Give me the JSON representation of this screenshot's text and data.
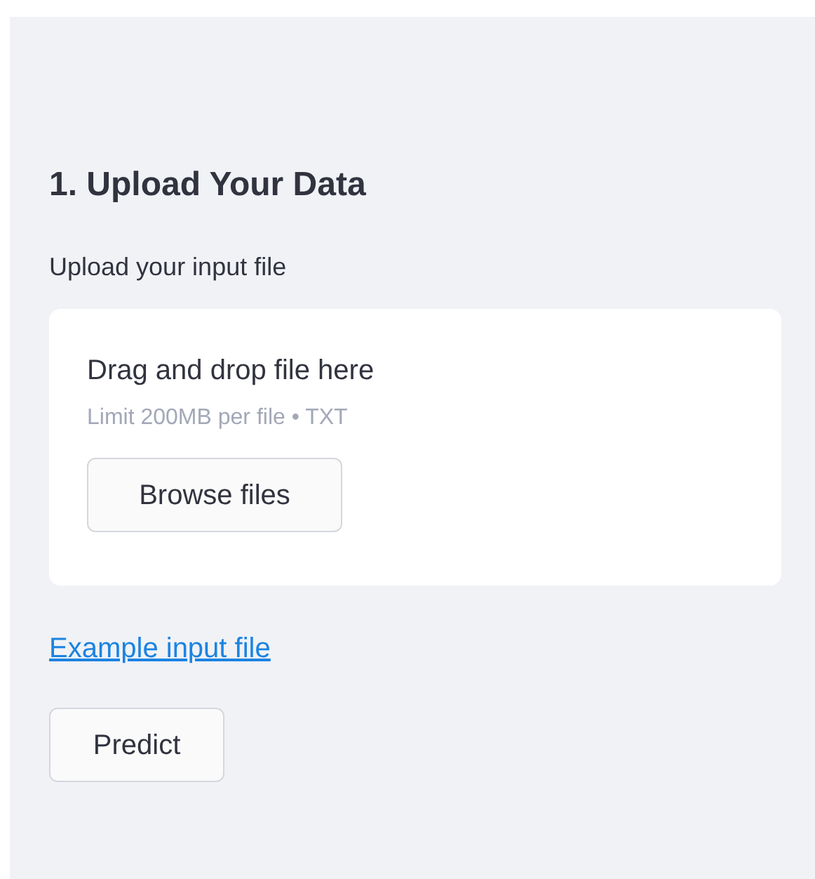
{
  "section_title": "1. Upload Your Data",
  "uploader": {
    "label": "Upload your input file",
    "instructions": "Drag and drop file here",
    "limits": "Limit 200MB per file • TXT",
    "button": "Browse files"
  },
  "link": "Example input file",
  "buttons": [
    "Predict"
  ]
}
